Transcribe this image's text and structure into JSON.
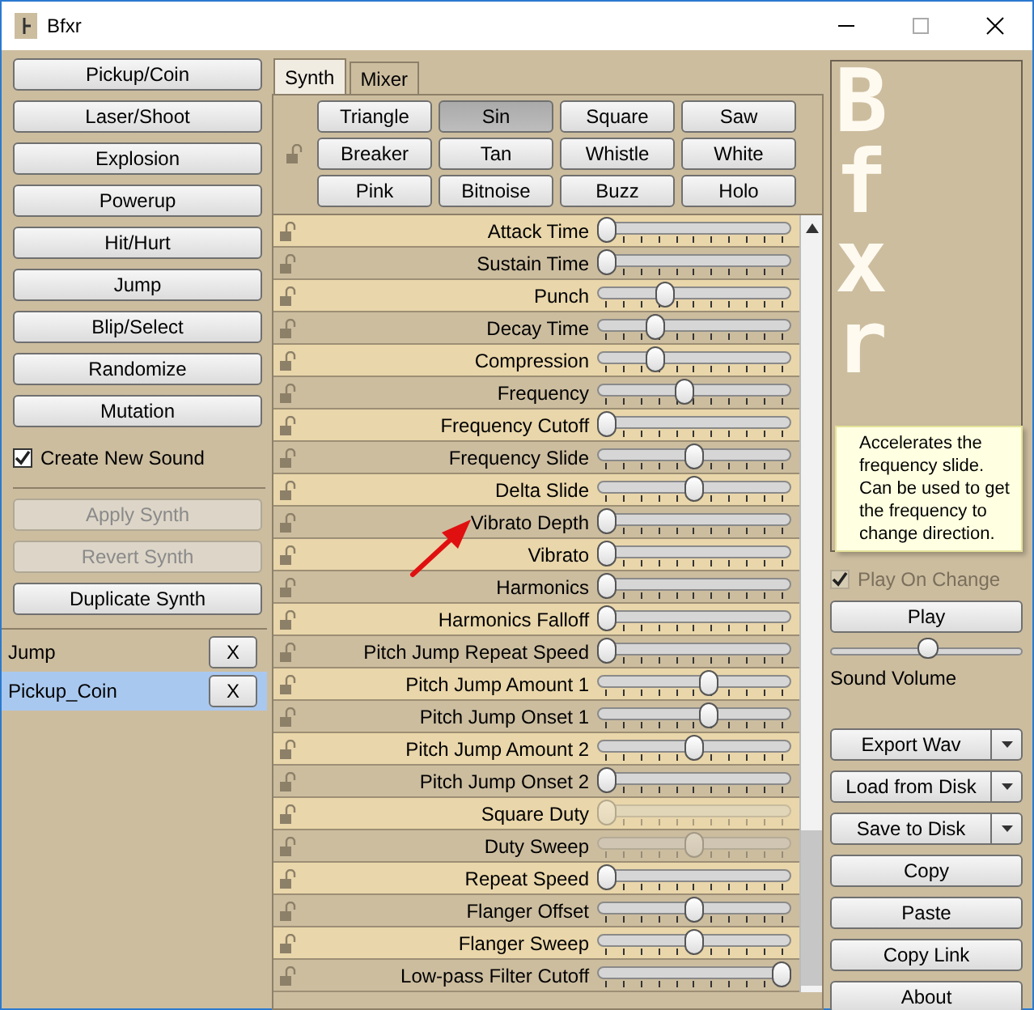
{
  "window": {
    "title": "Bfxr"
  },
  "generators": [
    {
      "label": "Pickup/Coin"
    },
    {
      "label": "Laser/Shoot"
    },
    {
      "label": "Explosion"
    },
    {
      "label": "Powerup"
    },
    {
      "label": "Hit/Hurt"
    },
    {
      "label": "Jump"
    },
    {
      "label": "Blip/Select"
    },
    {
      "label": "Randomize"
    },
    {
      "label": "Mutation"
    }
  ],
  "create_new_sound": {
    "label": "Create New Sound",
    "checked": true
  },
  "synth_actions": [
    {
      "label": "Apply Synth",
      "disabled": true
    },
    {
      "label": "Revert Synth",
      "disabled": true
    },
    {
      "label": "Duplicate Synth",
      "disabled": false
    }
  ],
  "sounds": [
    {
      "name": "Jump",
      "selected": false,
      "delete": "X"
    },
    {
      "name": "Pickup_Coin",
      "selected": true,
      "delete": "X"
    }
  ],
  "tabs": [
    {
      "label": "Synth",
      "selected": true
    },
    {
      "label": "Mixer",
      "selected": false
    }
  ],
  "waveforms": [
    {
      "label": "Triangle",
      "selected": false
    },
    {
      "label": "Sin",
      "selected": true
    },
    {
      "label": "Square",
      "selected": false
    },
    {
      "label": "Saw",
      "selected": false
    },
    {
      "label": "Breaker",
      "selected": false
    },
    {
      "label": "Tan",
      "selected": false
    },
    {
      "label": "Whistle",
      "selected": false
    },
    {
      "label": "White",
      "selected": false
    },
    {
      "label": "Pink",
      "selected": false
    },
    {
      "label": "Bitnoise",
      "selected": false
    },
    {
      "label": "Buzz",
      "selected": false
    },
    {
      "label": "Holo",
      "selected": false
    }
  ],
  "parameters": [
    {
      "label": "Attack Time",
      "level": 0,
      "disabled": false
    },
    {
      "label": "Sustain Time",
      "level": 0,
      "disabled": false
    },
    {
      "label": "Punch",
      "level": 0.33,
      "disabled": false
    },
    {
      "label": "Decay Time",
      "level": 0.28,
      "disabled": false
    },
    {
      "label": "Compression",
      "level": 0.28,
      "disabled": false
    },
    {
      "label": "Frequency",
      "level": 0.44,
      "disabled": false
    },
    {
      "label": "Frequency Cutoff",
      "level": 0,
      "disabled": false
    },
    {
      "label": "Frequency Slide",
      "level": 0.5,
      "disabled": false
    },
    {
      "label": "Delta Slide",
      "level": 0.5,
      "disabled": false
    },
    {
      "label": "Vibrato Depth",
      "level": 0,
      "disabled": false
    },
    {
      "label": "Vibrato",
      "level": 0,
      "disabled": false
    },
    {
      "label": "Harmonics",
      "level": 0,
      "disabled": false
    },
    {
      "label": "Harmonics Falloff",
      "level": 0,
      "disabled": false
    },
    {
      "label": "Pitch Jump Repeat Speed",
      "level": 0,
      "disabled": false
    },
    {
      "label": "Pitch Jump Amount 1",
      "level": 0.58,
      "disabled": false
    },
    {
      "label": "Pitch Jump Onset 1",
      "level": 0.58,
      "disabled": false
    },
    {
      "label": "Pitch Jump Amount 2",
      "level": 0.5,
      "disabled": false
    },
    {
      "label": "Pitch Jump Onset 2",
      "level": 0,
      "disabled": false
    },
    {
      "label": "Square Duty",
      "level": 0,
      "disabled": true
    },
    {
      "label": "Duty Sweep",
      "level": 0.5,
      "disabled": true
    },
    {
      "label": "Repeat Speed",
      "level": 0,
      "disabled": false
    },
    {
      "label": "Flanger Offset",
      "level": 0.5,
      "disabled": false
    },
    {
      "label": "Flanger Sweep",
      "level": 0.5,
      "disabled": false
    },
    {
      "label": "Low-pass Filter Cutoff",
      "level": 1,
      "disabled": false
    }
  ],
  "logo": "Bfxr",
  "play_on_change": {
    "label": "Play On Change",
    "checked": true,
    "disabled": true
  },
  "play_button": "Play",
  "volume": {
    "label": "Sound Volume",
    "level": 0.5
  },
  "file_buttons": [
    {
      "label": "Export Wav",
      "dropdown": true
    },
    {
      "label": "Load from Disk",
      "dropdown": true
    },
    {
      "label": "Save to Disk",
      "dropdown": true
    },
    {
      "label": "Copy",
      "dropdown": false
    },
    {
      "label": "Paste",
      "dropdown": false
    },
    {
      "label": "Copy Link",
      "dropdown": false
    },
    {
      "label": "About",
      "dropdown": false
    }
  ],
  "tooltip": {
    "text": "Accelerates the frequency slide.  Can be used to get the frequency to change direction."
  },
  "annotation": {
    "kind": "arrow"
  }
}
